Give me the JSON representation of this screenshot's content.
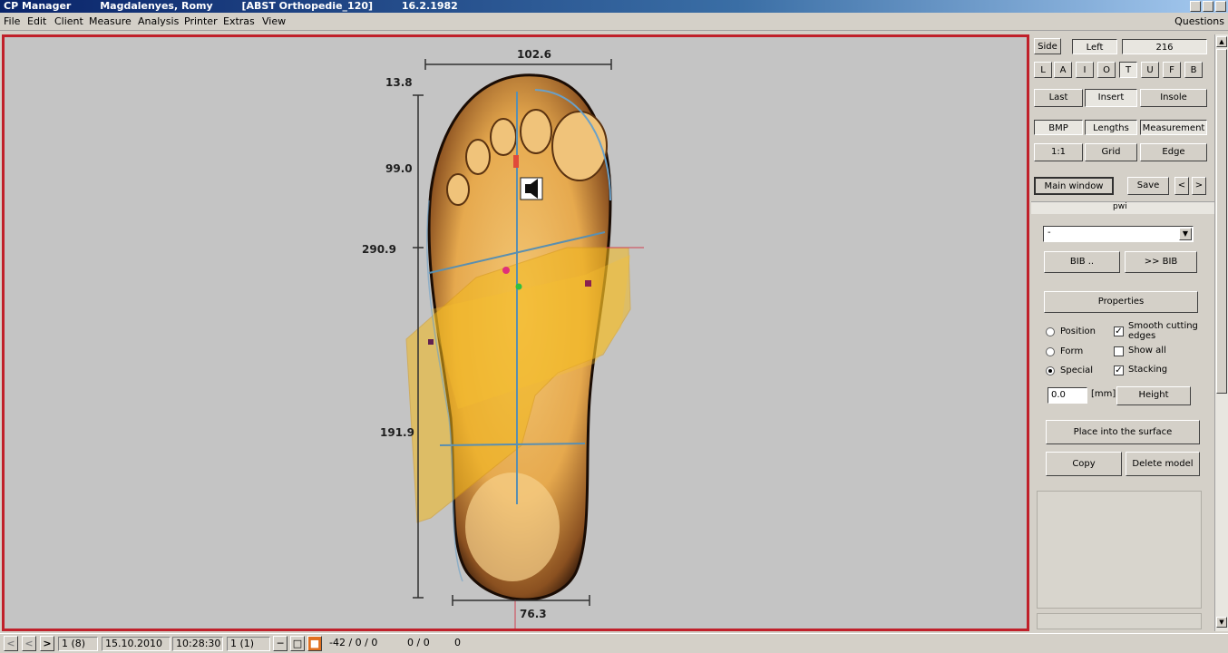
{
  "window": {
    "app": "CP Manager",
    "client": "Magdalenyes, Romy",
    "project": "[ABST Orthopedie_120]",
    "date": "16.2.1982"
  },
  "menu": [
    "File",
    "Edit",
    "Client",
    "Measure",
    "Analysis",
    "Printer",
    "Extras",
    "View"
  ],
  "menu_right": "Questions",
  "viewport": {
    "dim_top": "102.6",
    "dim_bottom": "76.3",
    "dim_left": [
      "13.8",
      "99.0",
      "290.9",
      "191.9"
    ]
  },
  "panel": {
    "side_label": "Side",
    "left_label": "Left",
    "size_value": "216",
    "letters": [
      "L",
      "A",
      "I",
      "O",
      "T",
      "U",
      "F",
      "B"
    ],
    "tabs_row1": [
      "Last",
      "Insert",
      "Insole"
    ],
    "tabs_row2": [
      "BMP",
      "Lengths",
      "Measurement"
    ],
    "tabs_row3": [
      "1:1",
      "Grid",
      "Edge"
    ],
    "main_window": "Main window",
    "save": "Save",
    "prev": "<",
    "next": ">",
    "group_label": "pwi",
    "select_value": "-",
    "bib_left": "BIB ..",
    "bib_right": ">> BIB",
    "properties": "Properties",
    "radios": [
      {
        "label": "Position",
        "on": false
      },
      {
        "label": "Form",
        "on": false
      },
      {
        "label": "Special",
        "on": true
      }
    ],
    "checks": [
      {
        "label": "Smooth cutting edges",
        "on": true
      },
      {
        "label": "Show all",
        "on": false
      },
      {
        "label": "Stacking",
        "on": true
      }
    ],
    "mm_value": "0.0",
    "mm_unit": "[mm]",
    "height": "Height",
    "place_surface": "Place into the surface",
    "copy": "Copy",
    "delete_model": "Delete model"
  },
  "status": {
    "page": "1 (8)",
    "date": "15.10.2010",
    "time": "10:28:30",
    "index": "1 (1)",
    "coords": "-42 / 0 / 0",
    "coords2": "0 / 0",
    "zero": "0"
  }
}
